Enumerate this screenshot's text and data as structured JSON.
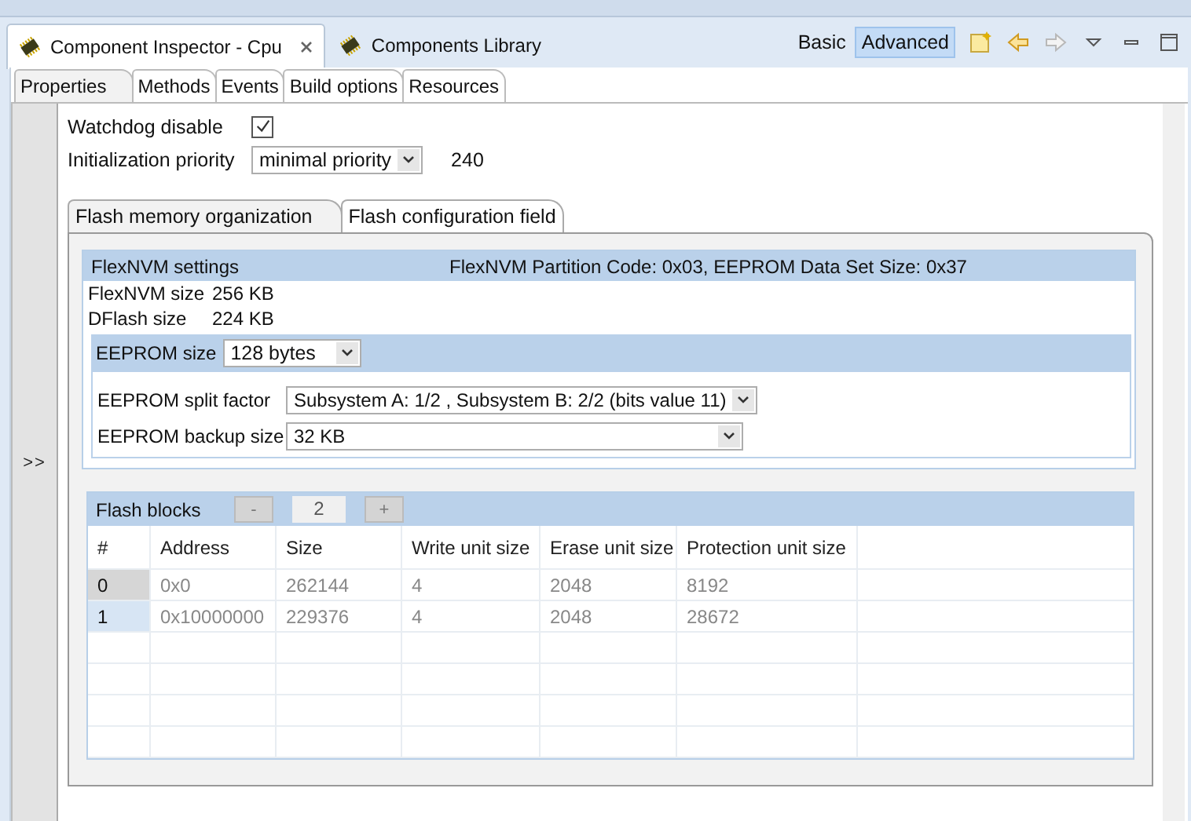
{
  "view_tabs": [
    {
      "label": "Component Inspector - Cpu",
      "selected": true,
      "closable": true
    },
    {
      "label": "Components Library",
      "selected": false,
      "closable": false
    }
  ],
  "mode_buttons": [
    {
      "label": "Basic",
      "selected": false
    },
    {
      "label": "Advanced",
      "selected": true
    }
  ],
  "property_tabs": [
    {
      "label": "Properties",
      "selected": true
    },
    {
      "label": "Methods",
      "selected": false
    },
    {
      "label": "Events",
      "selected": false
    },
    {
      "label": "Build options",
      "selected": false
    },
    {
      "label": "Resources",
      "selected": false
    }
  ],
  "collapse_button": ">>",
  "properties": [
    {
      "kind": "checkbox",
      "label": "Watchdog disable",
      "checked": true
    },
    {
      "kind": "select",
      "label": "Initialization priority",
      "value": "minimal priority",
      "reading": "240"
    }
  ],
  "section_tabs": [
    {
      "label": "Flash memory organization",
      "selected": true
    },
    {
      "label": "Flash configuration field",
      "selected": false
    }
  ],
  "flexnvm": {
    "title": "FlexNVM settings",
    "info": "FlexNVM Partition Code: 0x03, EEPROM Data Set Size: 0x37",
    "fields": [
      {
        "label": "FlexNVM size",
        "value": "256 KB"
      },
      {
        "label": "DFlash size",
        "value": "224 KB"
      }
    ],
    "eeprom_size": {
      "label": "EEPROM size",
      "value": "128 bytes"
    },
    "eeprom_fields": [
      {
        "label": "EEPROM split factor",
        "value": "Subsystem A: 1/2 , Subsystem B: 2/2 (bits value 11)"
      },
      {
        "label": "EEPROM backup size",
        "value": "32 KB"
      }
    ]
  },
  "flash_blocks": {
    "title": "Flash blocks",
    "minus": "-",
    "count": "2",
    "plus": "+",
    "columns": [
      "#",
      "Address",
      "Size",
      "Write unit size",
      "Erase unit size",
      "Protection unit size"
    ],
    "rows": [
      {
        "selected": false,
        "cells": [
          "0",
          "0x0",
          "262144",
          "4",
          "2048",
          "8192"
        ]
      },
      {
        "selected": true,
        "cells": [
          "1",
          "0x10000000",
          "229376",
          "4",
          "2048",
          "28672"
        ]
      }
    ]
  }
}
